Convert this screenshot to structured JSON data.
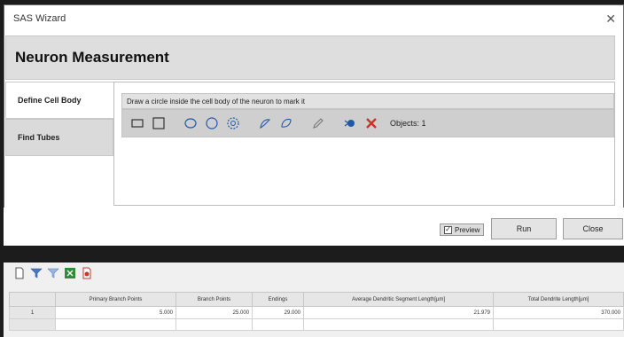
{
  "window": {
    "title": "SAS Wizard",
    "close_glyph": "✕"
  },
  "header": {
    "title": "Neuron Measurement"
  },
  "sidebar": {
    "items": [
      {
        "label": "Define Cell Body"
      },
      {
        "label": "Find Tubes"
      }
    ]
  },
  "instruction": "Draw a circle inside the cell body of the neuron to mark it",
  "toolbar": {
    "icons": [
      "rectangle-icon",
      "square-icon",
      "ellipse-icon",
      "circle-icon",
      "circle-dashed-icon",
      "freehand-icon",
      "freehand-closed-icon",
      "pencil-icon",
      "object-select-icon",
      "delete-icon"
    ],
    "objects_label": "Objects: 1",
    "accent": "#1f5aa6",
    "delete_color": "#d0302a"
  },
  "footer": {
    "preview_label": "Preview",
    "preview_checked": true,
    "run_label": "Run",
    "close_label": "Close"
  },
  "results": {
    "toolbar_icons": [
      "document-icon",
      "filter-icon",
      "filter-options-icon",
      "excel-export-icon",
      "pdf-export-icon"
    ],
    "columns": [
      "",
      "Primary Branch Points",
      "Branch Points",
      "Endings",
      "Average Dendritic Segment Length[µm]",
      "Total Dendrite Length[µm]"
    ],
    "rows": [
      [
        "1",
        "5.000",
        "25.000",
        "29.000",
        "21.979",
        "370.000"
      ]
    ]
  }
}
